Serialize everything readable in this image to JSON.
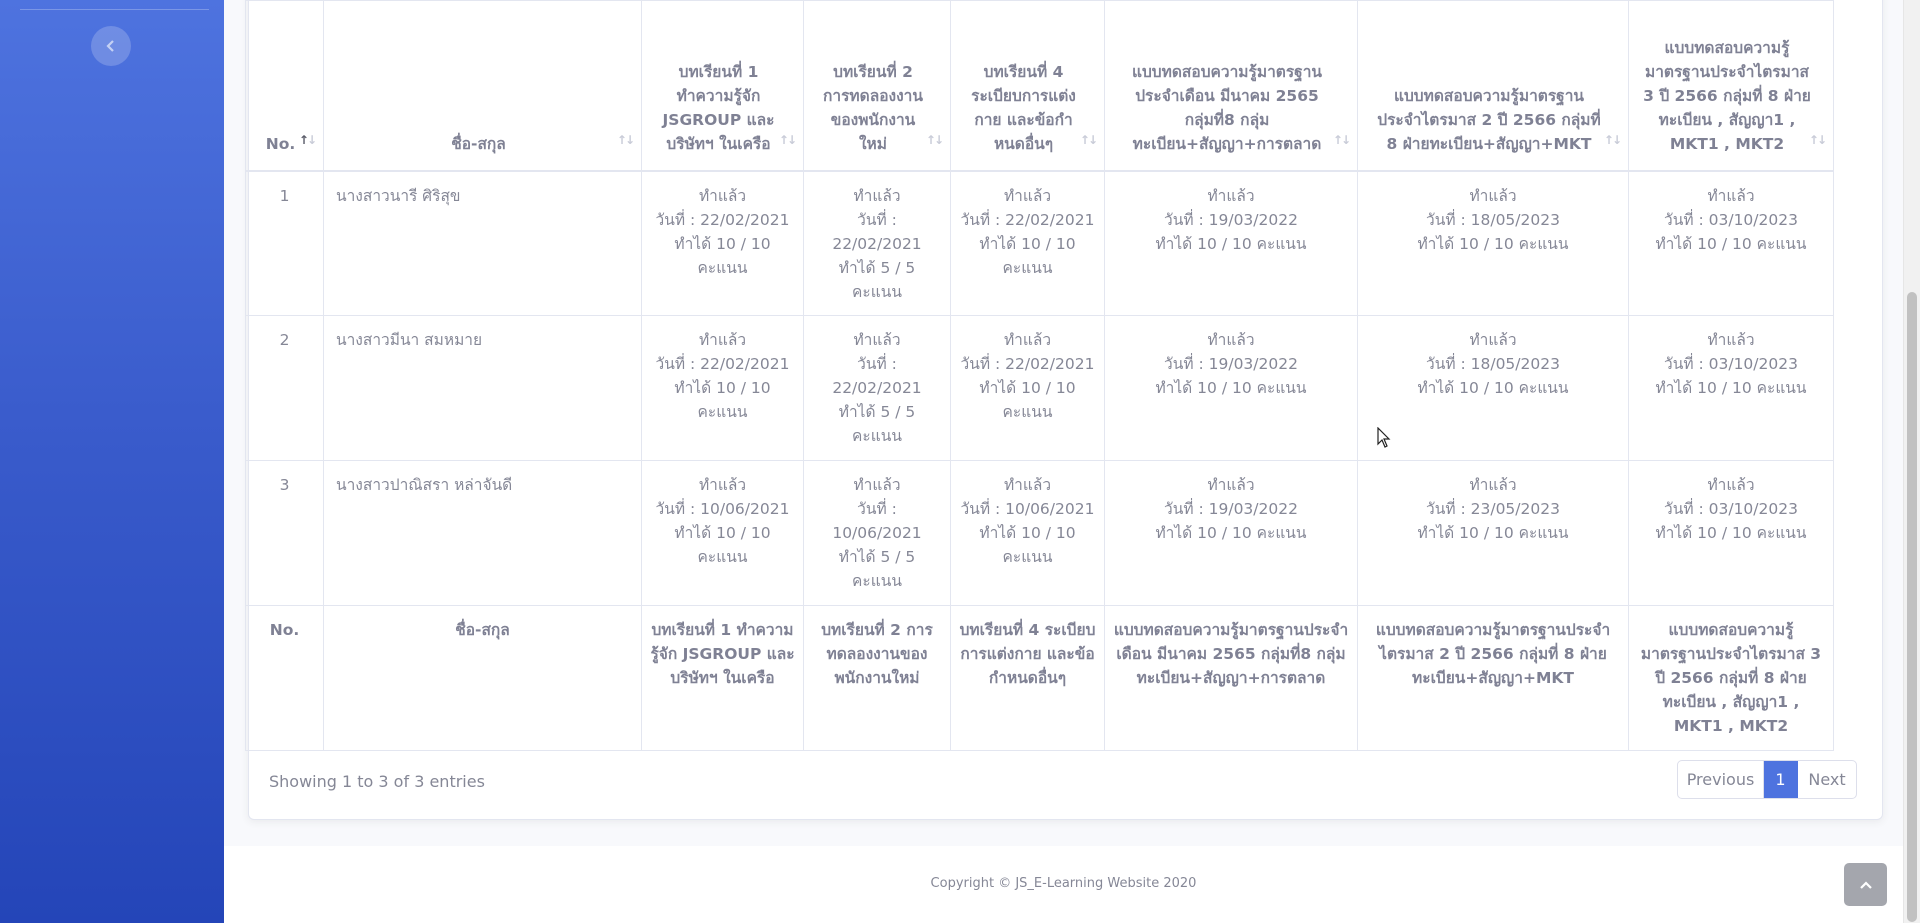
{
  "sidebar": {
    "toggle_icon": "chevron-left-icon",
    "bg_color": "#4e73df"
  },
  "table": {
    "headers": [
      "No.",
      "ชื่อ-สกุล",
      "บทเรียนที่ 1 ทำความรู้จัก JSGROUP และบริษัทฯ ในเครือ",
      "บทเรียนที่ 2 การทดลองงานของพนักงานใหม่",
      "บทเรียนที่ 4 ระเบียบการแต่งกาย และข้อกำหนดอื่นๆ",
      "แบบทดสอบความรู้มาตรฐานประจำเดือน มีนาคม 2565 กลุ่มที่8 กลุ่มทะเบียน+สัญญา+การตลาด",
      "แบบทดสอบความรู้มาตรฐานประจำไตรมาส 2 ปี 2566 กลุ่มที่ 8 ฝ่ายทะเบียน+สัญญา+MKT",
      "แบบทดสอบความรู้มาตรฐานประจำไตรมาส 3 ปี 2566 กลุ่มที่ 8 ฝ่ายทะเบียน , สัญญา1 , MKT1 , MKT2"
    ],
    "rows": [
      {
        "no": "1",
        "name": "นางสาวนารี ศิริสุข",
        "cells": [
          [
            "ทำแล้ว",
            "วันที่ : 22/02/2021",
            "ทำได้ 10 / 10 คะแนน"
          ],
          [
            "ทำแล้ว",
            "วันที่ : 22/02/2021",
            "ทำได้ 5 / 5 คะแนน"
          ],
          [
            "ทำแล้ว",
            "วันที่ : 22/02/2021",
            "ทำได้ 10 / 10 คะแนน"
          ],
          [
            "ทำแล้ว",
            "วันที่ : 19/03/2022",
            "ทำได้ 10 / 10 คะแนน"
          ],
          [
            "ทำแล้ว",
            "วันที่ : 18/05/2023",
            "ทำได้ 10 / 10 คะแนน"
          ],
          [
            "ทำแล้ว",
            "วันที่ : 03/10/2023",
            "ทำได้ 10 / 10 คะแนน"
          ]
        ]
      },
      {
        "no": "2",
        "name": "นางสาวมีนา สมหมาย",
        "cells": [
          [
            "ทำแล้ว",
            "วันที่ : 22/02/2021",
            "ทำได้ 10 / 10 คะแนน"
          ],
          [
            "ทำแล้ว",
            "วันที่ : 22/02/2021",
            "ทำได้ 5 / 5 คะแนน"
          ],
          [
            "ทำแล้ว",
            "วันที่ : 22/02/2021",
            "ทำได้ 10 / 10 คะแนน"
          ],
          [
            "ทำแล้ว",
            "วันที่ : 19/03/2022",
            "ทำได้ 10 / 10 คะแนน"
          ],
          [
            "ทำแล้ว",
            "วันที่ : 18/05/2023",
            "ทำได้ 10 / 10 คะแนน"
          ],
          [
            "ทำแล้ว",
            "วันที่ : 03/10/2023",
            "ทำได้ 10 / 10 คะแนน"
          ]
        ]
      },
      {
        "no": "3",
        "name": "นางสาวปาณิสรา หล่าจันดี",
        "cells": [
          [
            "ทำแล้ว",
            "วันที่ : 10/06/2021",
            "ทำได้ 10 / 10 คะแนน"
          ],
          [
            "ทำแล้ว",
            "วันที่ : 10/06/2021",
            "ทำได้ 5 / 5 คะแนน"
          ],
          [
            "ทำแล้ว",
            "วันที่ : 10/06/2021",
            "ทำได้ 10 / 10 คะแนน"
          ],
          [
            "ทำแล้ว",
            "วันที่ : 19/03/2022",
            "ทำได้ 10 / 10 คะแนน"
          ],
          [
            "ทำแล้ว",
            "วันที่ : 23/05/2023",
            "ทำได้ 10 / 10 คะแนน"
          ],
          [
            "ทำแล้ว",
            "วันที่ : 03/10/2023",
            "ทำได้ 10 / 10 คะแนน"
          ]
        ]
      }
    ]
  },
  "info_text": "Showing 1 to 3 of 3 entries",
  "pagination": {
    "previous": "Previous",
    "current": "1",
    "next": "Next"
  },
  "footer": {
    "copyright": "Copyright © JS_E-Learning Website 2020"
  },
  "colors": {
    "primary": "#4e73df",
    "text": "#858796"
  },
  "icons": {
    "scroll_top": "chevron-up-icon",
    "sort": "sort-arrows-icon"
  }
}
